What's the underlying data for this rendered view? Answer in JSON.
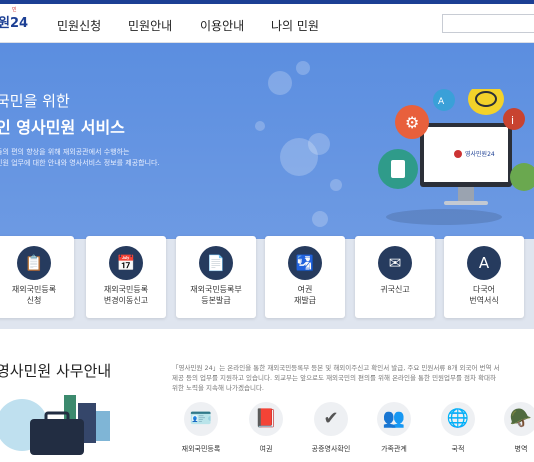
{
  "header": {
    "logo_small": "민",
    "logo_text": "원",
    "logo_num": "24",
    "nav": [
      "민원신청",
      "민원안내",
      "이용안내",
      "나의 민원"
    ]
  },
  "hero": {
    "title_line1": "국민을 위한",
    "title_line2": "인 영사민원 서비스",
    "desc_line1": "들의 편의 향상을 위해 재외공관에서 수행하는",
    "desc_line2": "민원 업무에 대한 안내와 영사서비스 정보를 제공합니다.",
    "monitor_label": "영사민원24"
  },
  "cards": [
    {
      "label": "재외국민등록\n신청",
      "icon": "registration-form-icon"
    },
    {
      "label": "재외국민등록\n변경이동신고",
      "icon": "calendar-change-icon"
    },
    {
      "label": "재외국민등록부\n등본발급",
      "icon": "certificate-icon"
    },
    {
      "label": "여권\n재발급",
      "icon": "passport-icon"
    },
    {
      "label": "귀국신고",
      "icon": "return-report-icon"
    },
    {
      "label": "다국어\n번역서식",
      "icon": "translation-icon"
    }
  ],
  "section": {
    "title": "영사민원 사무안내",
    "info_line1": "「영사민원 24」는 온라인을 통한 재외국민등록부 등본 및 해외이주신고 확인서 발급, 주요 민원서류 8개 외국어 번역 서",
    "info_line2": "제공 등의 업무를 지원하고 있습니다. 외교부는 앞으로도 재외국민의 편의를 위해 온라인을 통한 민원업무를 점차 확대하",
    "info_line3": "위한 노력을 지속해 나가겠습니다."
  },
  "services": [
    {
      "label": "재외국민등록",
      "icon": "id-card-icon"
    },
    {
      "label": "여권",
      "icon": "passport-icon"
    },
    {
      "label": "공증영사확인",
      "icon": "verified-badge-icon"
    },
    {
      "label": "가족관계",
      "icon": "family-icon"
    },
    {
      "label": "국적",
      "icon": "globe-icon"
    },
    {
      "label": "병역",
      "icon": "soldier-icon"
    }
  ],
  "colors": {
    "primary": "#1c3f94",
    "hero": "#6094e2",
    "card_icon": "#263b5e"
  }
}
